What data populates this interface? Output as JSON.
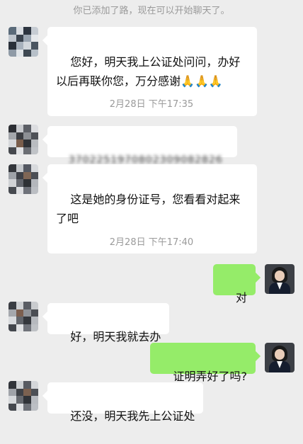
{
  "system_notice": "你已添加了路，现在可以开始聊天了。",
  "timestamps": [
    "2月28日 下午17:35",
    "2月28日 下午17:40"
  ],
  "messages": [
    {
      "side": "in",
      "text": "您好，明天我上公证处问问，办好以后再联你您，万分感谢",
      "emoji": "🙏🙏🙏"
    },
    {
      "side": "in",
      "text": "3702251970802309082826",
      "blurred": true
    },
    {
      "side": "in",
      "text": "这是她的身份证号，您看看对起来了吧"
    },
    {
      "side": "out",
      "text": "对"
    },
    {
      "side": "in",
      "text": "好，明天我就去办"
    },
    {
      "side": "out",
      "text": "证明弄好了吗?"
    },
    {
      "side": "in",
      "text": "还没，明天我先上公证处"
    }
  ],
  "avatars": {
    "contact": "mosaic-avatar",
    "self": "person-avatar"
  },
  "colors": {
    "background": "#ededed",
    "incoming_bubble": "#ffffff",
    "outgoing_bubble": "#95ec69",
    "meta_text": "#9a9a9a"
  }
}
